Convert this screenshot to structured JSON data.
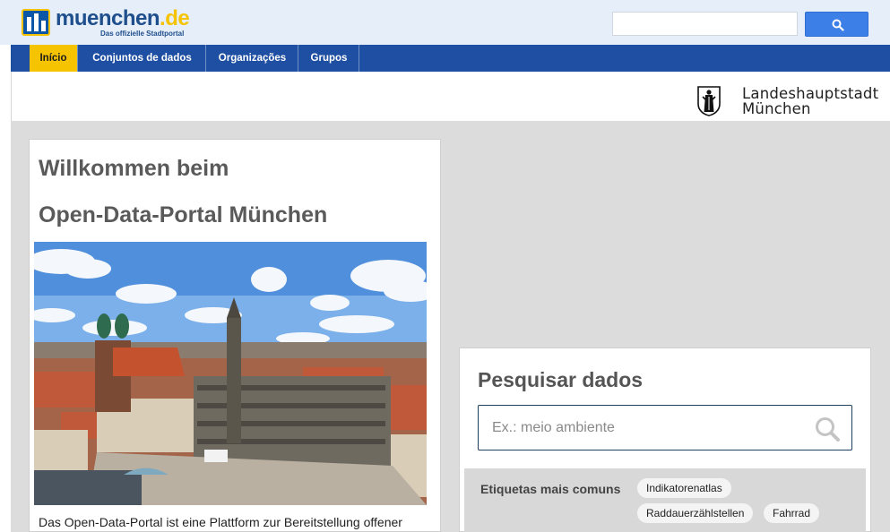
{
  "header": {
    "logo_text": "muenchen",
    "logo_tld": ".de",
    "logo_subtitle": "Das offizielle Stadtportal",
    "search_value": "",
    "search_button_icon": "search-icon"
  },
  "nav": {
    "items": [
      {
        "label": "Início",
        "active": true
      },
      {
        "label": "Conjuntos de dados",
        "active": false
      },
      {
        "label": "Organizações",
        "active": false
      },
      {
        "label": "Grupos",
        "active": false
      }
    ]
  },
  "brand": {
    "city_line1": "Landeshauptstadt",
    "city_line2": "München"
  },
  "welcome": {
    "title_line1": "Willkommen beim",
    "title_line2": "Open-Data-Portal München",
    "intro_text": "Das Open-Data-Portal ist eine Plattform zur Bereitstellung offener"
  },
  "search": {
    "heading": "Pesquisar dados",
    "placeholder": "Ex.: meio ambiente",
    "value": "",
    "tags_label": "Etiquetas mais comuns",
    "tags": [
      "Indikatorenatlas",
      "Raddauerzählstellen",
      "Fahrrad"
    ]
  },
  "colors": {
    "nav_background": "#1f4fa2",
    "nav_active": "#f5c300",
    "header_background": "#e6eef9",
    "search_button": "#3c7fe6",
    "content_background": "#dcdcdc"
  }
}
